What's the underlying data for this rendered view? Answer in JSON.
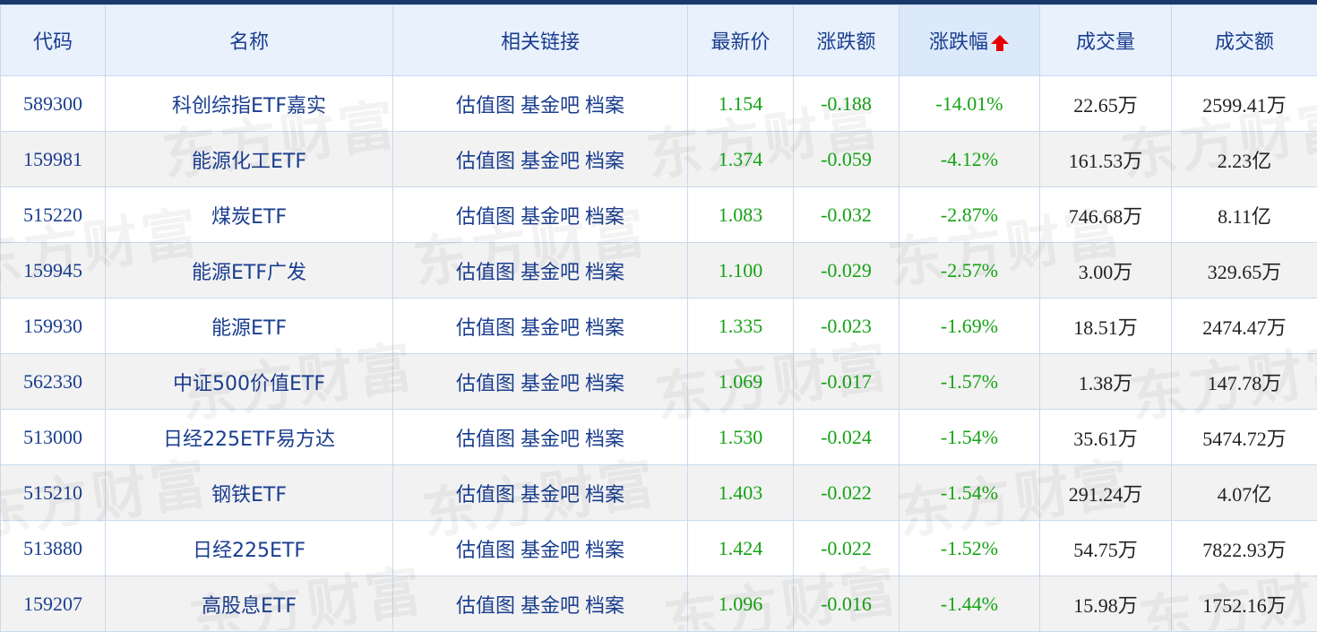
{
  "colors": {
    "header_text": "#1a3d8f",
    "header_bg": "#e8f1fc",
    "fall": "#14a314",
    "sort_arrow": "#e60000",
    "top_bar": "#1b3a6b"
  },
  "watermark_text": "东方财富",
  "headers": {
    "code": "代码",
    "name": "名称",
    "links": "相关链接",
    "price": "最新价",
    "change": "涨跌额",
    "change_pct": "涨跌幅",
    "volume": "成交量",
    "amount": "成交额"
  },
  "sort": {
    "column": "change_pct",
    "direction": "up",
    "icon": "arrow-up-icon"
  },
  "link_labels": {
    "chart": "估值图",
    "forum": "基金吧",
    "profile": "档案"
  },
  "rows": [
    {
      "code": "589300",
      "name": "科创综指ETF嘉实",
      "price": "1.154",
      "change": "-0.188",
      "change_pct": "-14.01%",
      "volume": "22.65万",
      "amount": "2599.41万"
    },
    {
      "code": "159981",
      "name": "能源化工ETF",
      "price": "1.374",
      "change": "-0.059",
      "change_pct": "-4.12%",
      "volume": "161.53万",
      "amount": "2.23亿"
    },
    {
      "code": "515220",
      "name": "煤炭ETF",
      "price": "1.083",
      "change": "-0.032",
      "change_pct": "-2.87%",
      "volume": "746.68万",
      "amount": "8.11亿"
    },
    {
      "code": "159945",
      "name": "能源ETF广发",
      "price": "1.100",
      "change": "-0.029",
      "change_pct": "-2.57%",
      "volume": "3.00万",
      "amount": "329.65万"
    },
    {
      "code": "159930",
      "name": "能源ETF",
      "price": "1.335",
      "change": "-0.023",
      "change_pct": "-1.69%",
      "volume": "18.51万",
      "amount": "2474.47万"
    },
    {
      "code": "562330",
      "name": "中证500价值ETF",
      "price": "1.069",
      "change": "-0.017",
      "change_pct": "-1.57%",
      "volume": "1.38万",
      "amount": "147.78万"
    },
    {
      "code": "513000",
      "name": "日经225ETF易方达",
      "price": "1.530",
      "change": "-0.024",
      "change_pct": "-1.54%",
      "volume": "35.61万",
      "amount": "5474.72万"
    },
    {
      "code": "515210",
      "name": "钢铁ETF",
      "price": "1.403",
      "change": "-0.022",
      "change_pct": "-1.54%",
      "volume": "291.24万",
      "amount": "4.07亿"
    },
    {
      "code": "513880",
      "name": "日经225ETF",
      "price": "1.424",
      "change": "-0.022",
      "change_pct": "-1.52%",
      "volume": "54.75万",
      "amount": "7822.93万"
    },
    {
      "code": "159207",
      "name": "高股息ETF",
      "price": "1.096",
      "change": "-0.016",
      "change_pct": "-1.44%",
      "volume": "15.98万",
      "amount": "1752.16万"
    }
  ]
}
